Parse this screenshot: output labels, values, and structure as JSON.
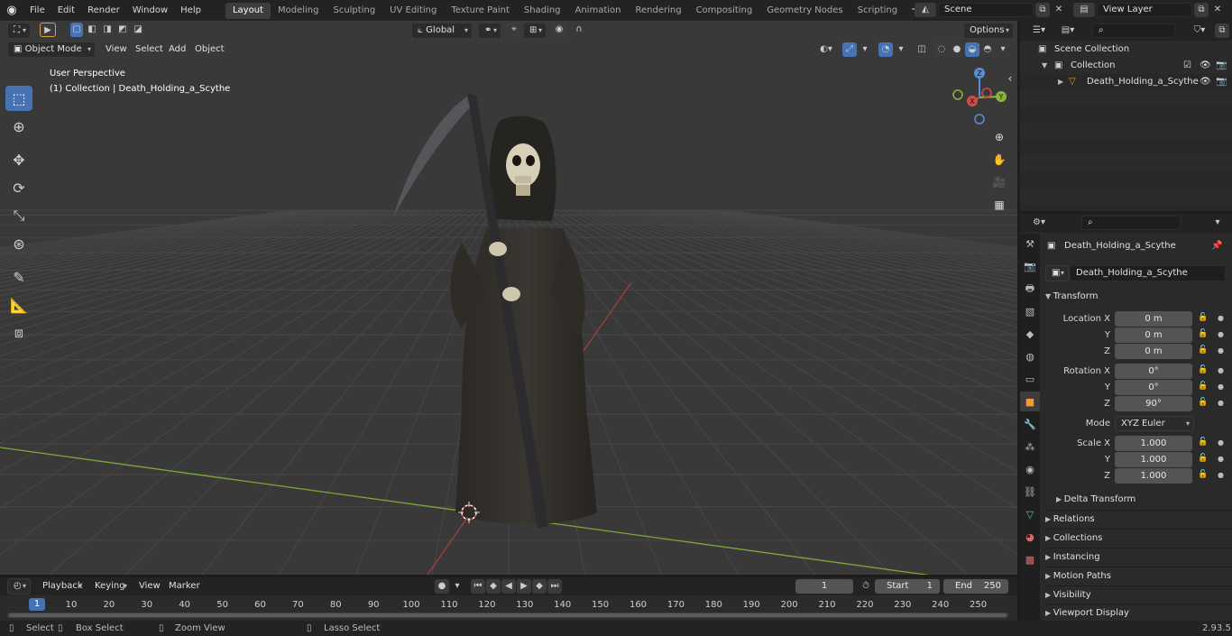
{
  "topbar": {
    "menus": [
      "File",
      "Edit",
      "Render",
      "Window",
      "Help"
    ],
    "workspaces": [
      "Layout",
      "Modeling",
      "Sculpting",
      "UV Editing",
      "Texture Paint",
      "Shading",
      "Animation",
      "Rendering",
      "Compositing",
      "Geometry Nodes",
      "Scripting"
    ],
    "active_workspace": "Layout",
    "scene_name": "Scene",
    "view_layer": "View Layer"
  },
  "viewport": {
    "transform_orientation": "Global",
    "mode": "Object Mode",
    "menus": [
      "View",
      "Select",
      "Add",
      "Object"
    ],
    "options_label": "Options",
    "perspective": "User Perspective",
    "collection_info": "(1) Collection | Death_Holding_a_Scythe",
    "gizmo_axes": [
      "X",
      "Y",
      "Z"
    ],
    "colors": {
      "background": "#393939",
      "x_axis": "#a83a3a",
      "y_axis": "#7fa83a",
      "grid": "#474747",
      "active_tool": "#4772b3"
    }
  },
  "outliner": {
    "scene_collection": "Scene Collection",
    "collection": "Collection",
    "object": "Death_Holding_a_Scythe"
  },
  "properties": {
    "object_name": "Death_Holding_a_Scythe",
    "object_field": "Death_Holding_a_Scythe",
    "transform_title": "Transform",
    "location": {
      "label": "Location X",
      "x": "0 m",
      "y": "0 m",
      "z": "0 m"
    },
    "rotation": {
      "label": "Rotation X",
      "x": "0°",
      "y": "0°",
      "z": "90°"
    },
    "mode_label": "Mode",
    "mode_value": "XYZ Euler",
    "scale": {
      "label": "Scale X",
      "x": "1.000",
      "y": "1.000",
      "z": "1.000"
    },
    "axis_labels": {
      "y": "Y",
      "z": "Z"
    },
    "delta": "Delta Transform",
    "panels": [
      "Relations",
      "Collections",
      "Instancing",
      "Motion Paths",
      "Visibility",
      "Viewport Display"
    ]
  },
  "timeline": {
    "menus": [
      "Playback",
      "Keying",
      "View",
      "Marker"
    ],
    "current_frame": "1",
    "start_label": "Start",
    "start": "1",
    "end_label": "End",
    "end": "250",
    "playhead": "1",
    "ticks": [
      "10",
      "20",
      "30",
      "40",
      "50",
      "60",
      "70",
      "80",
      "90",
      "100",
      "110",
      "120",
      "130",
      "140",
      "150",
      "160",
      "170",
      "180",
      "190",
      "200",
      "210",
      "220",
      "230",
      "240",
      "250"
    ]
  },
  "statusbar": {
    "select": "Select",
    "box_select": "Box Select",
    "zoom_view": "Zoom View",
    "lasso_select": "Lasso Select",
    "version": "2.93.5"
  }
}
